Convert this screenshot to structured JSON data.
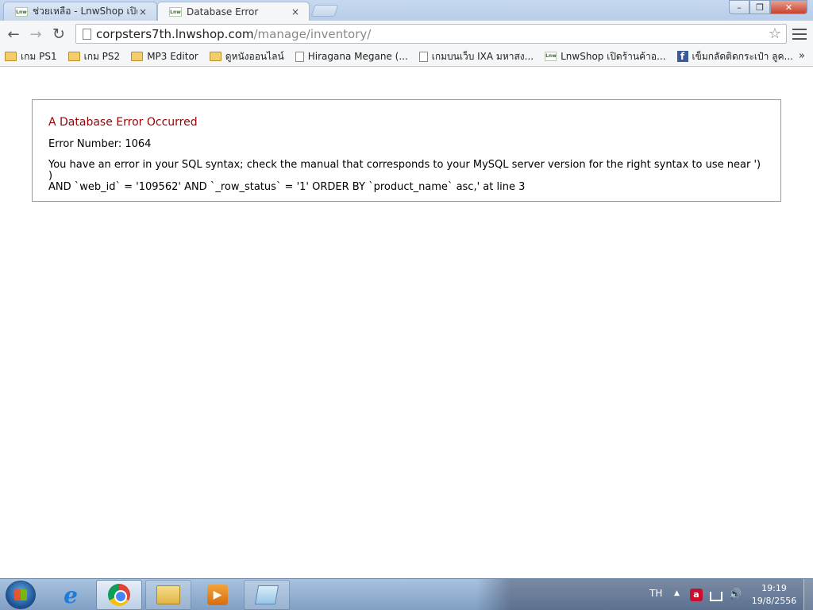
{
  "browser": {
    "tabs": [
      {
        "label": "ช่วยเหลือ - LnwShop เปิดร้า",
        "favicon": "lnw-favicon",
        "close": "×"
      },
      {
        "label": "Database Error",
        "favicon": "lnw-favicon",
        "close": "×"
      }
    ],
    "window_controls": {
      "minimize": "–",
      "maximize": "❐",
      "close": "✕"
    },
    "nav": {
      "back": "←",
      "forward": "→",
      "reload": "↻"
    },
    "address": {
      "host": "corpsters7th.lnwshop.com",
      "path": "/manage/inventory/"
    },
    "star": "☆",
    "bookmarks": [
      {
        "label": "เกม PS1",
        "icon": "folder-icon"
      },
      {
        "label": "เกม PS2",
        "icon": "folder-icon"
      },
      {
        "label": "MP3 Editor",
        "icon": "folder-icon"
      },
      {
        "label": "ดูหนังออนไลน์",
        "icon": "folder-icon"
      },
      {
        "label": "Hiragana Megane (...",
        "icon": "page-icon"
      },
      {
        "label": "เกมบนเว็บ IXA มหาสง...",
        "icon": "page-icon"
      },
      {
        "label": "LnwShop เปิดร้านค้าอ...",
        "icon": "lnw-icon"
      },
      {
        "label": "เข็มกลัดติดกระเป๋า ลูค...",
        "icon": "facebook-icon"
      }
    ],
    "bookmarks_more": "»"
  },
  "error": {
    "title": "A Database Error Occurred",
    "number_line": "Error Number: 1064",
    "message_line1": "You have an error in your SQL syntax; check the manual that corresponds to your MySQL server version for the right syntax to use near ') )",
    "message_line2": "AND `web_id` = '109562' AND `_row_status` = '1' ORDER BY `product_name` asc,' at line 3"
  },
  "taskbar": {
    "language": "TH",
    "tray_arrow": "▲",
    "clock_time": "19:19",
    "clock_date": "19/8/2556",
    "apps": [
      "internet-explorer",
      "google-chrome",
      "windows-explorer",
      "media-player",
      "notes"
    ]
  }
}
